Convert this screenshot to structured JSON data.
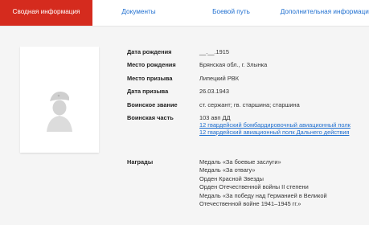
{
  "tabs": [
    {
      "label": "Сводная информация",
      "active": true
    },
    {
      "label": "Документы",
      "active": false
    },
    {
      "label": "Боевой путь",
      "active": false
    },
    {
      "label": "Дополнительная информация",
      "active": false
    }
  ],
  "person": {
    "birth_date_label": "Дата рождения",
    "birth_date": "__.__.1915",
    "birth_place_label": "Место рождения",
    "birth_place": "Брянская обл., г. Злынка",
    "draft_place_label": "Место призыва",
    "draft_place": "Липецкий РВК",
    "draft_date_label": "Дата призыва",
    "draft_date": "26.03.1943",
    "rank_label": "Воинское звание",
    "rank": "ст. сержант; гв. старшина; старшина",
    "unit_label": "Воинская часть",
    "unit_text": "103 авп ДД",
    "unit_links": [
      "12 гвардейский бомбардировочный авиационный полк",
      "12 гвардейский авиационный полк Дальнего действия"
    ],
    "awards_label": "Награды",
    "awards": [
      "Медаль «За боевые заслуги»",
      "Медаль «За отвагу»",
      "Орден Красной Звезды",
      "Орден Отечественной войны II степени",
      "Медаль «За победу над Германией в Великой Отечественной войне 1941–1945 гг.»"
    ]
  },
  "colors": {
    "accent": "#d52b1e",
    "link": "#1f6fd0",
    "background": "#f5f5f5"
  },
  "icons": {
    "photo": "soldier-silhouette-icon"
  }
}
